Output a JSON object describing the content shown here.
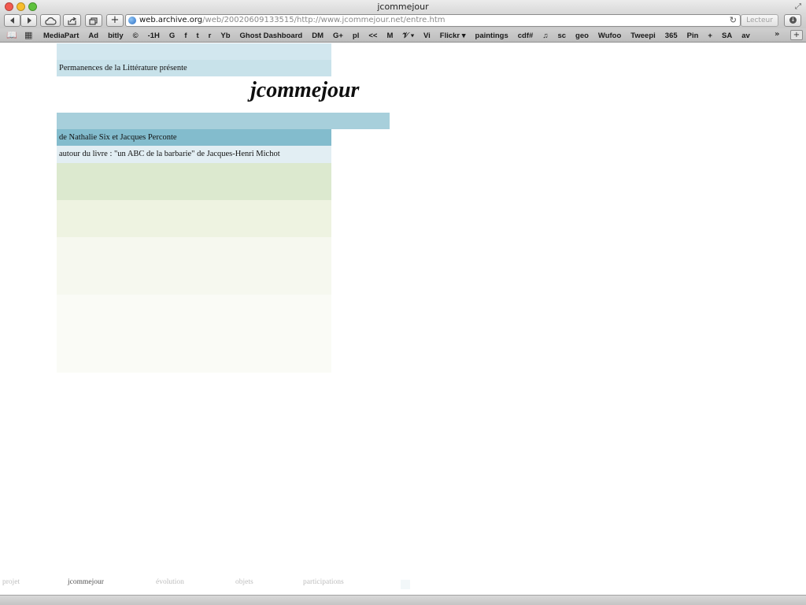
{
  "window": {
    "title": "jcommejour"
  },
  "toolbar": {
    "back_icon": "back-arrow-icon",
    "forward_icon": "forward-arrow-icon",
    "icloud_icon": "cloud-icon",
    "share_icon": "share-icon",
    "tabs_icon": "tabs-icon",
    "new_tab_label": "+",
    "url": {
      "host": "web.archive.org",
      "rest": "/web/20020609133515/http://www.jcommejour.net/entre.htm"
    },
    "reader_label": "Lecteur"
  },
  "bookmarks": {
    "items": [
      "MediaPart",
      "Ad",
      "bitly",
      "©",
      "-1H",
      "G",
      "f",
      "t",
      "r",
      "Yb",
      "Ghost Dashboard",
      "DM",
      "G+",
      "pl",
      "<<",
      "M",
      "𝒱 ▾",
      "Vi",
      "Flickr ▾",
      "paintings",
      "cdf#",
      "♫",
      "sc",
      "geo",
      "Wufoo",
      "Tweepi",
      "365",
      "Pin",
      "+",
      "SA",
      "av"
    ],
    "more_label": "»",
    "add_label": "+"
  },
  "page": {
    "presenter": "Permanences de la Littérature présente",
    "title": "jcommejour",
    "authors": "de Nathalie Six et Jacques Perconte",
    "book": "autour du livre : \"un ABC de la barbarie\" de Jacques-Henri Michot",
    "colors": {
      "band_light": "#d2e7ef",
      "band_mid": "#a7cfdb",
      "band_dark": "#83bccd",
      "green1": "#dce9cf"
    }
  },
  "footer_nav": {
    "items": [
      "projet",
      "jcommejour",
      "évolution",
      "objets",
      "participations"
    ],
    "active": "jcommejour"
  }
}
